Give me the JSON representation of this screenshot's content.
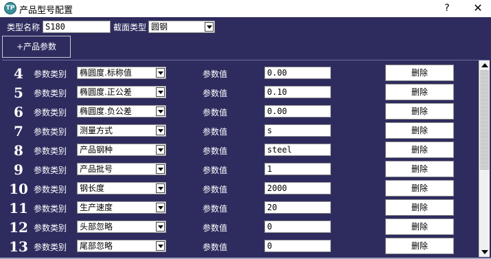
{
  "window": {
    "title": "产品型号配置",
    "help_label": "?",
    "close_label": "✕",
    "icon_text": "TP"
  },
  "top": {
    "type_name_label": "类型名称",
    "type_name_value": "S180",
    "section_type_label": "截面类型",
    "section_type_value": "圆钢"
  },
  "add_param_label": "+产品参数",
  "row_labels": {
    "category": "参数类别",
    "value": "参数值",
    "delete": "删除"
  },
  "rows": [
    {
      "num": "4",
      "category": "椭圆度.标称值",
      "value": "0.00"
    },
    {
      "num": "5",
      "category": "椭圆度.正公差",
      "value": "0.10"
    },
    {
      "num": "6",
      "category": "椭圆度.负公差",
      "value": "0.00"
    },
    {
      "num": "7",
      "category": "测量方式",
      "value": "s"
    },
    {
      "num": "8",
      "category": "产品钢种",
      "value": "steel"
    },
    {
      "num": "9",
      "category": "产品批号",
      "value": "1"
    },
    {
      "num": "10",
      "category": "钢长度",
      "value": "2000"
    },
    {
      "num": "11",
      "category": "生产速度",
      "value": "20"
    },
    {
      "num": "12",
      "category": "头部忽略",
      "value": "0"
    },
    {
      "num": "13",
      "category": "尾部忽略",
      "value": "0"
    }
  ],
  "colors": {
    "background": "#2e2c5e",
    "text": "#ffffff"
  }
}
